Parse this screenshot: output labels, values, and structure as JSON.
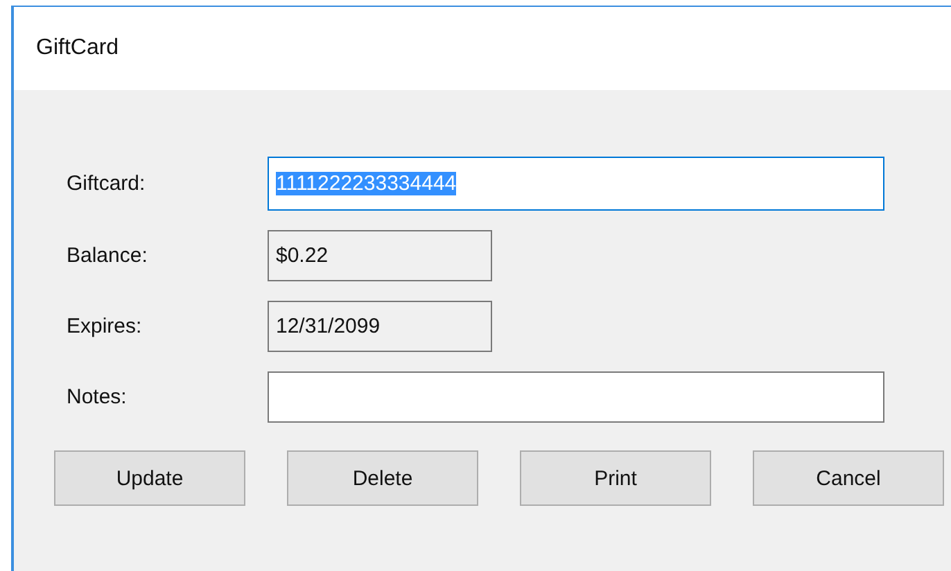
{
  "window": {
    "title": "GiftCard"
  },
  "fields": [
    {
      "label": "Giftcard:",
      "value": "1111222233334444",
      "readonly": false,
      "focused": true,
      "text_selected": true,
      "wide": true
    },
    {
      "label": "Balance:",
      "value": "$0.22",
      "readonly": true,
      "focused": false,
      "text_selected": false,
      "wide": false
    },
    {
      "label": "Expires:",
      "value": "12/31/2099",
      "readonly": true,
      "focused": false,
      "text_selected": false,
      "wide": false
    },
    {
      "label": "Notes:",
      "readonly": false,
      "focused": false,
      "wide": true
    }
  ],
  "buttons": [
    "Update",
    "Delete",
    "Print",
    "Cancel"
  ]
}
